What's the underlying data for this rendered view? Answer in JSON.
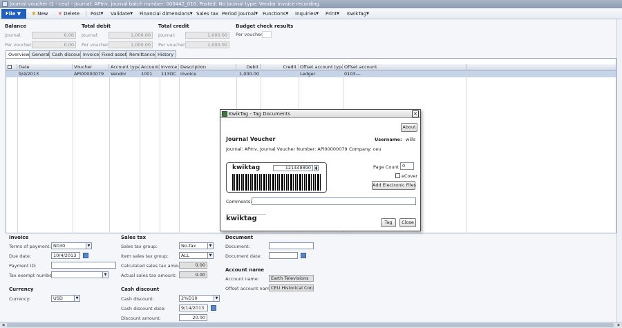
{
  "window": {
    "title": "Journal voucher (1 - ceu) - Journal: APInv, journal batch number: 000442_010, Posted: No Journal type: Vendor invoice recording"
  },
  "toolbar": {
    "file": "File",
    "new": "New",
    "delete": "Delete",
    "menus": [
      "Post",
      "Validate",
      "Financial dimensions",
      "Sales tax",
      "Period journal",
      "Functions",
      "Inquiries",
      "Print",
      "KwikTag"
    ]
  },
  "balance": {
    "header": "Balance",
    "journal_label": "Journal:",
    "journal_value": "0.00",
    "voucher_label": "Per voucher:",
    "voucher_value": "0.00"
  },
  "total_debit": {
    "header": "Total debit",
    "journal_label": "Journal:",
    "journal_value": "1,000.00",
    "voucher_label": "Per voucher:",
    "voucher_value": "1,000.00"
  },
  "total_credit": {
    "header": "Total credit",
    "journal_label": "Journal:",
    "journal_value": "1,000.00",
    "voucher_label": "Per voucher:",
    "voucher_value": "1,000.00"
  },
  "budget": {
    "header": "Budget check results",
    "voucher_label": "Per voucher:"
  },
  "tabs": [
    "Overview",
    "General",
    "Cash discount",
    "Invoice",
    "Fixed assets",
    "Remittance",
    "History"
  ],
  "grid": {
    "columns": [
      "Date",
      "Voucher",
      "Account type",
      "Account",
      "Invoice",
      "Description",
      "Debit",
      "Credit",
      "Offset account type",
      "Offset account"
    ],
    "row": [
      "9/4/2013",
      "APi00000079",
      "Vendor",
      "1001",
      "113OC",
      "invoice",
      "1,000.00",
      "",
      "Ledger",
      "0103---"
    ]
  },
  "dialog": {
    "title": "KwikTag - Tag Documents",
    "about": "About",
    "heading": "Journal Voucher",
    "username_label": "Username:",
    "username": "wills",
    "info": "Journal: APInv, Journal Voucher Number: APi00000079",
    "company": "Company: ceu",
    "logo": "kwiktag",
    "barcode_number": "121448890",
    "page_count_label": "Page Count",
    "page_count": "0",
    "ecover_label": "eCover",
    "add_files": "Add Electronic Files",
    "comments_label": "Comments:",
    "footer_logo": "kwiktag",
    "tag": "Tag",
    "close": "Close"
  },
  "invoice": {
    "header": "Invoice",
    "terms_label": "Terms of payment:",
    "terms": "N030",
    "due_label": "Due date:",
    "due": "10/4/2013",
    "payment_id_label": "Payment ID:",
    "payment_id": "",
    "tax_exempt_label": "Tax exempt number:",
    "tax_exempt": ""
  },
  "currency": {
    "header": "Currency",
    "label": "Currency:",
    "value": "USD"
  },
  "sales_tax": {
    "header": "Sales tax",
    "group_label": "Sales tax group:",
    "group": "No-Tax",
    "item_group_label": "Item sales tax group:",
    "item_group": "ALL",
    "calc_label": "Calculated sales tax amount:",
    "calc": "0.00",
    "actual_label": "Actual sales tax amount:",
    "actual": "0.00"
  },
  "cash_discount": {
    "header": "Cash discount",
    "discount_label": "Cash discount:",
    "discount": "2%D10",
    "date_label": "Cash discount date:",
    "date": "9/14/2013",
    "amount_label": "Discount amount:",
    "amount": "20.00"
  },
  "document": {
    "header": "Document",
    "doc_label": "Document:",
    "doc": "",
    "date_label": "Document date:",
    "date": ""
  },
  "account_name": {
    "header": "Account name",
    "name_label": "Account name:",
    "name": "Earth Televisions",
    "offset_label": "Offset account name:",
    "offset": "CEU Historical Consol"
  }
}
